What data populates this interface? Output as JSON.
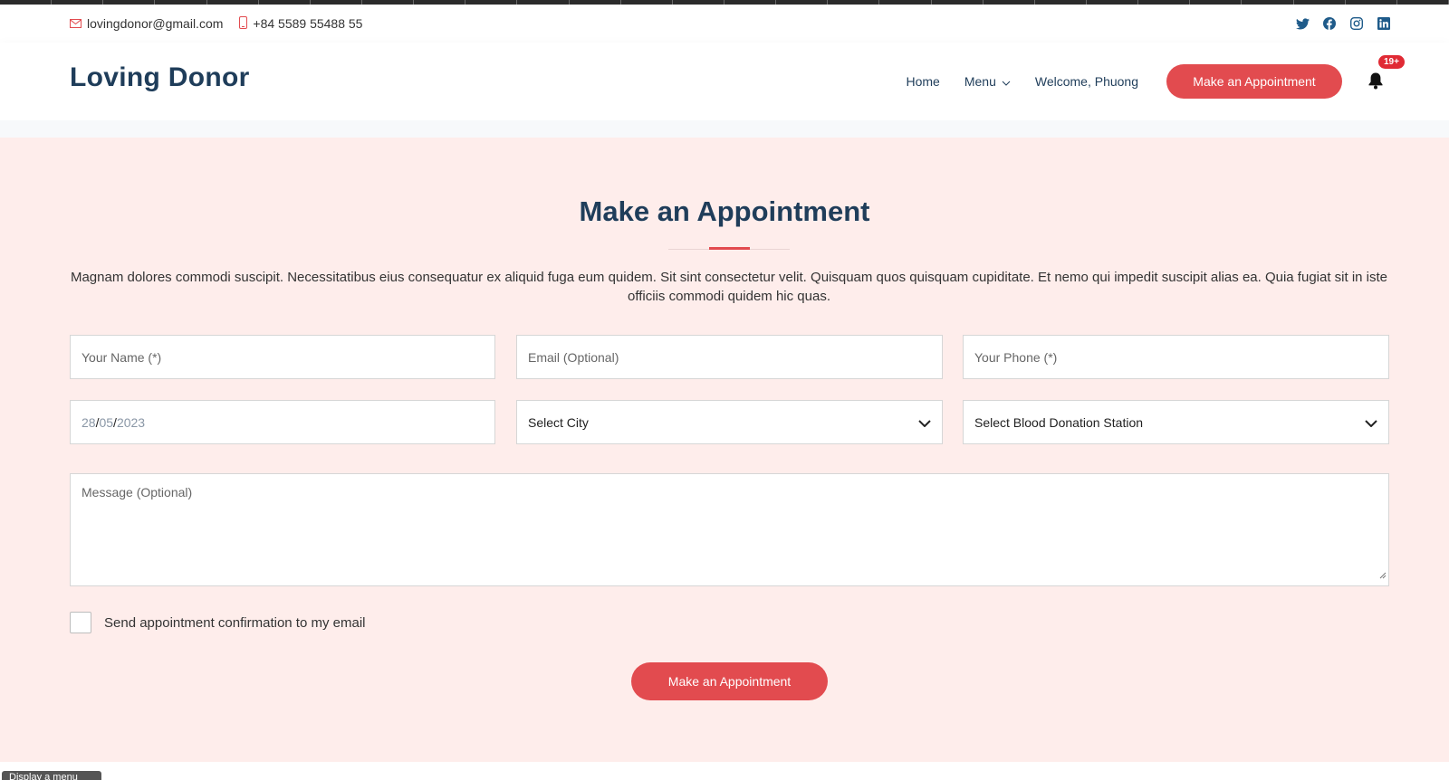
{
  "topbar": {
    "email": "lovingdonor@gmail.com",
    "phone": "+84 5589 55488 55",
    "social_icons": [
      "twitter-icon",
      "facebook-icon",
      "instagram-icon",
      "linkedin-icon"
    ]
  },
  "header": {
    "logo": "Loving Donor",
    "nav": {
      "home": "Home",
      "menu": "Menu",
      "welcome": "Welcome, Phuong"
    },
    "appointment_button": "Make an Appointment",
    "notification_badge": "19+"
  },
  "section": {
    "title": "Make an Appointment",
    "description": "Magnam dolores commodi suscipit. Necessitatibus eius consequatur ex aliquid fuga eum quidem. Sit sint consectetur velit. Quisquam quos quisquam cupiditate. Et nemo qui impedit suscipit alias ea. Quia fugiat sit in iste officiis commodi quidem hic quas."
  },
  "form": {
    "name_placeholder": "Your Name (*)",
    "email_placeholder": "Email (Optional)",
    "phone_placeholder": "Your Phone (*)",
    "date": {
      "day": "28",
      "month": "05",
      "year": "2023",
      "separator": "/"
    },
    "city_select": "Select City",
    "station_select": "Select Blood Donation Station",
    "message_placeholder": "Message (Optional)",
    "confirm_label": "Send appointment confirmation to my email",
    "submit_label": "Make an Appointment"
  },
  "footer_tab": "Display a menu",
  "colors": {
    "accent": "#e24b4f",
    "navy": "#1f3d5a",
    "section_bg": "#feedeb",
    "badge": "#e02a34"
  }
}
